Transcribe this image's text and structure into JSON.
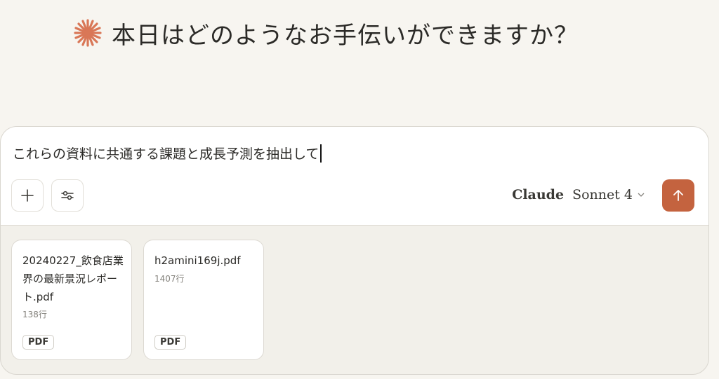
{
  "greeting": {
    "text": "本日はどのようなお手伝いができますか？",
    "logo_icon": "sparkle-logo-icon",
    "logo_color": "#d97757"
  },
  "composer": {
    "prompt_text": "これらの資料に共通する課題と成長予測を抽出して",
    "attach_icon": "plus-icon",
    "tools_icon": "sliders-icon",
    "model": {
      "name": "Claude",
      "version": "Sonnet 4",
      "dropdown_icon": "chevron-down-icon"
    },
    "send_icon": "arrow-up-icon",
    "send_color": "#c4633f"
  },
  "attachments": [
    {
      "name": "20240227_飲食店業界の最新景況レポート.pdf",
      "lines": "138行",
      "badge": "PDF"
    },
    {
      "name": "h2amini169j.pdf",
      "lines": "1407行",
      "badge": "PDF"
    }
  ]
}
